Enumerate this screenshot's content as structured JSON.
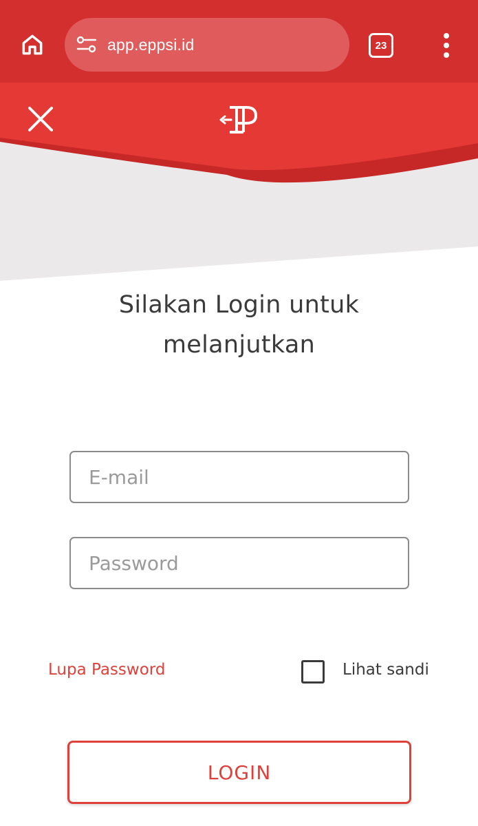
{
  "browser": {
    "url": "app.eppsi.id",
    "tab_count": "23",
    "home_icon": "home-icon",
    "site_settings_icon": "tune-icon",
    "menu_icon": "more-vertical-icon"
  },
  "header": {
    "close_icon": "close-icon",
    "logo": "eppsi-logo",
    "colors": {
      "primary": "#e53935",
      "dark_red": "#c62828",
      "chrome_red": "#d42f2f",
      "background_grey": "#ebe9e9"
    }
  },
  "login": {
    "title_line1": "Silakan Login untuk",
    "title_line2": "melanjutkan",
    "email_placeholder": "E-mail",
    "email_value": "",
    "password_placeholder": "Password",
    "password_value": "",
    "forgot_password": "Lupa Password",
    "show_password_label": "Lihat sandi",
    "show_password_checked": false,
    "login_button": "LOGIN"
  }
}
